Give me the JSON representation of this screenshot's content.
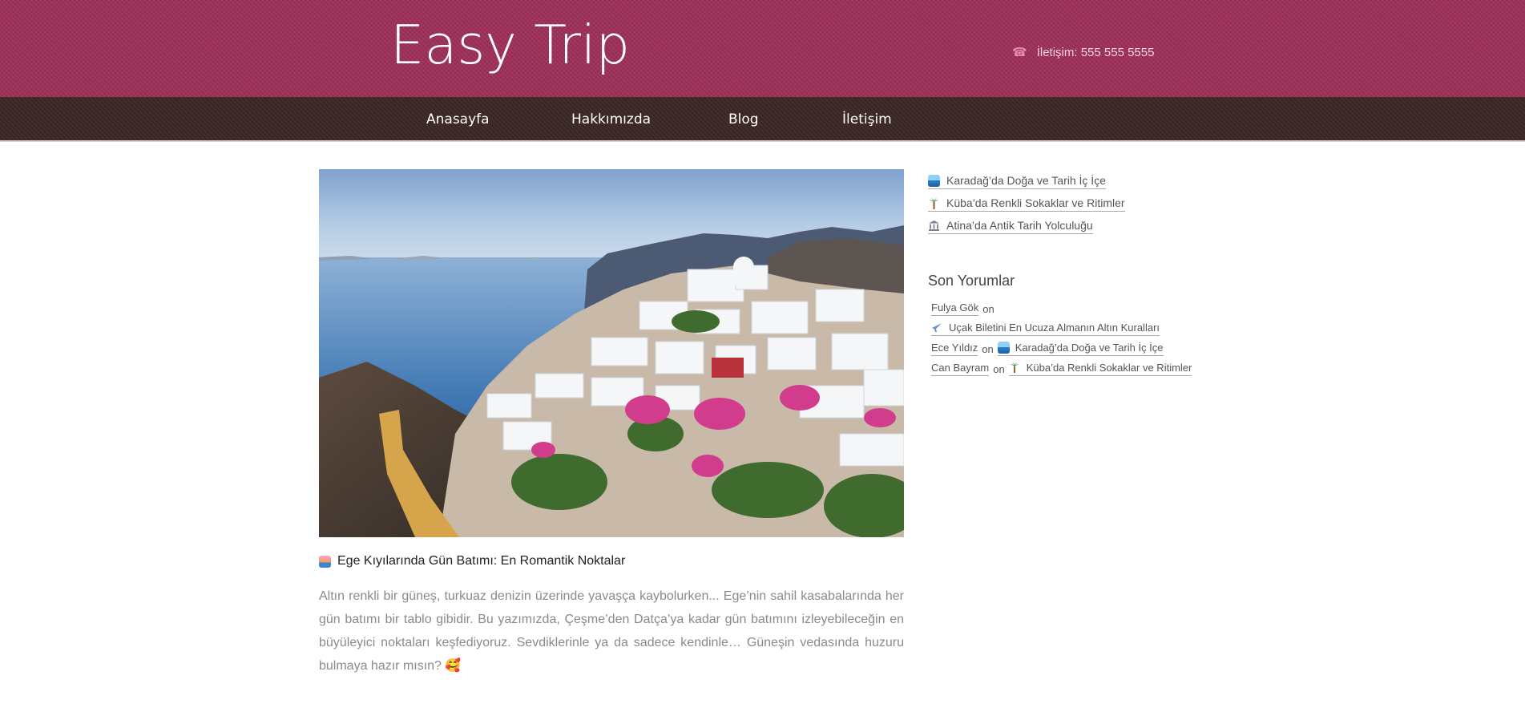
{
  "header": {
    "logo": "Easy Trip",
    "contact_label": "İletişim: 555 555 5555",
    "phone_icon": "phone-icon",
    "brand_color": "#9e2f58"
  },
  "nav": {
    "items": [
      {
        "label": "Anasayfa"
      },
      {
        "label": "Hakkımızda"
      },
      {
        "label": "Blog"
      },
      {
        "label": "İletişim"
      }
    ],
    "background_color": "#3c2825"
  },
  "main": {
    "hero_image": "santorini-coast-photo",
    "post": {
      "title": "Ege Kıyılarında Gün Batımı: En Romantik Noktalar",
      "title_icon": "sunset-icon",
      "excerpt": "Altın renkli bir güneş, turkuaz denizin üzerinde yavaşça kaybolurken... Ege’nin sahil kasabalarında her gün batımı bir tablo gibidir. Bu yazımızda, Çeşme’den Datça’ya kadar gün batımını izleyebileceğin en büyüleyici noktaları keşfediyoruz. Sevdiklerinle ya da sadece kendinle… Güneşin vedasında huzuru bulmaya hazır mısın? 🥰"
    }
  },
  "sidebar": {
    "recent_posts": [
      {
        "icon": "seaside-icon",
        "label": "Karadağ’da Doğa ve Tarih İç İçe"
      },
      {
        "icon": "palm-tree-icon",
        "label": "Küba’da Renkli Sokaklar ve Ritimler"
      },
      {
        "icon": "classical-building-icon",
        "label": "Atina’da Antik Tarih Yolculuğu"
      }
    ],
    "comments_title": "Son Yorumlar",
    "comments": {
      "c1_author": "Fulya Gök",
      "c1_on": "on",
      "c1_post": "Uçak Biletini En Ucuza Almanın Altın Kuralları",
      "c2_author": "Ece Yıldız",
      "c2_on": "on",
      "c2_post": "Karadağ’da Doğa ve Tarih İç İçe",
      "c3_author": "Can Bayram",
      "c3_on": "on",
      "c3_post": "Küba’da Renkli Sokaklar ve Ritimler"
    }
  }
}
